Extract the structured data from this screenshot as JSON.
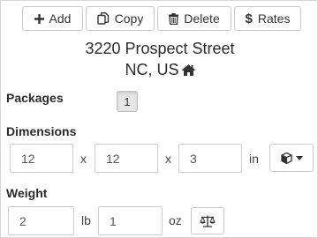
{
  "toolbar": {
    "add_label": "Add",
    "copy_label": "Copy",
    "delete_label": "Delete",
    "rates_label": "Rates"
  },
  "address": {
    "street": "3220 Prospect Street",
    "region": "NC, US"
  },
  "packages": {
    "label": "Packages",
    "selected": "1"
  },
  "dimensions": {
    "label": "Dimensions",
    "length": "12",
    "width": "12",
    "height": "3",
    "separator": "x",
    "unit": "in"
  },
  "weight": {
    "label": "Weight",
    "pounds": "2",
    "pounds_unit": "lb",
    "ounces": "1",
    "ounces_unit": "oz"
  },
  "icons": {
    "add": "plus-icon",
    "copy": "copy-icon",
    "delete": "trash-icon",
    "rates": "dollar-icon",
    "address": "home-icon",
    "package_type": "cube-icon",
    "scale": "balance-scale-icon"
  }
}
